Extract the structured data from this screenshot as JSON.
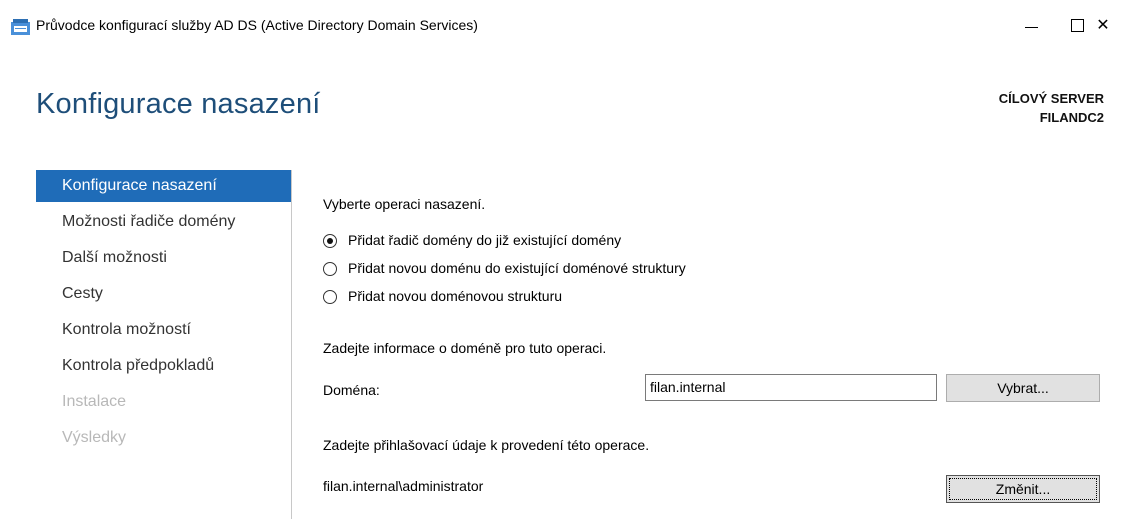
{
  "window": {
    "title": "Průvodce konfigurací služby AD DS (Active Directory Domain Services)",
    "close_glyph": "✕"
  },
  "header": {
    "page_title": "Konfigurace nasazení",
    "target_label": "CÍLOVÝ SERVER",
    "target_name": "FILANDC2"
  },
  "sidebar": {
    "items": [
      {
        "label": "Konfigurace nasazení",
        "state": "active"
      },
      {
        "label": "Možnosti řadiče domény",
        "state": "enabled"
      },
      {
        "label": "Další možnosti",
        "state": "enabled"
      },
      {
        "label": "Cesty",
        "state": "enabled"
      },
      {
        "label": "Kontrola možností",
        "state": "enabled"
      },
      {
        "label": "Kontrola předpokladů",
        "state": "enabled"
      },
      {
        "label": "Instalace",
        "state": "disabled"
      },
      {
        "label": "Výsledky",
        "state": "disabled"
      }
    ]
  },
  "main": {
    "operation_prompt": "Vyberte operaci nasazení.",
    "options": [
      {
        "label": "Přidat řadič domény do již existující domény",
        "checked": true
      },
      {
        "label": "Přidat novou doménu do existující doménové struktury",
        "checked": false
      },
      {
        "label": "Přidat novou doménovou strukturu",
        "checked": false
      }
    ],
    "domain_info_prompt": "Zadejte informace o doméně pro tuto operaci.",
    "domain_label": "Doména:",
    "domain_value": "filan.internal",
    "select_button": "Vybrat...",
    "credentials_prompt": "Zadejte přihlašovací údaje k provedení této operace.",
    "credentials_value": "filan.internal\\administrator",
    "change_button": "Změnit..."
  },
  "colors": {
    "accent": "#1f6cb8",
    "title": "#1e4e79",
    "disabled": "#b8b8b8"
  }
}
